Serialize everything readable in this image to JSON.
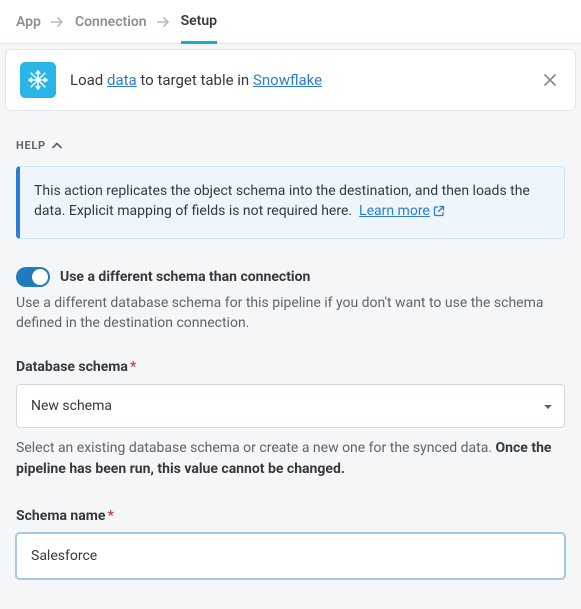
{
  "tabs": {
    "app": "App",
    "connection": "Connection",
    "setup": "Setup"
  },
  "header": {
    "lead": "Load",
    "data_link": "data",
    "mid": "to target table in",
    "dest_link": "Snowflake"
  },
  "help_label": "HELP",
  "info": {
    "text": "This action replicates the object schema into the destination, and then loads the data. Explicit mapping of fields is not required here.",
    "learn_more": "Learn more"
  },
  "toggle": {
    "label": "Use a different schema than connection",
    "help": "Use a different database schema for this pipeline if you don't want to use the schema defined in the destination connection."
  },
  "fields": {
    "db_schema_label": "Database schema",
    "db_schema_value": "New schema",
    "db_schema_help_a": "Select an existing database schema or create a new one for the synced data. ",
    "db_schema_help_b": "Once the pipeline has been run, this value cannot be changed.",
    "schema_name_label": "Schema name",
    "schema_name_value": "Salesforce"
  }
}
